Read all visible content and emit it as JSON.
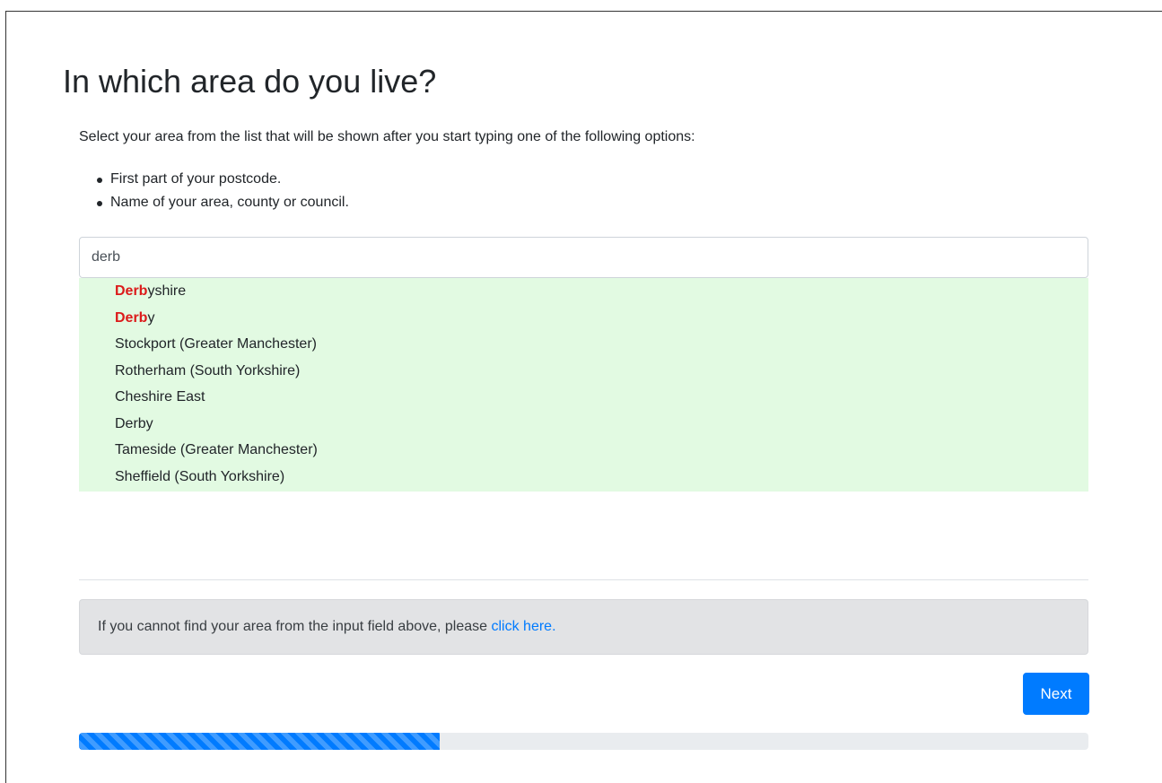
{
  "page": {
    "title": "In which area do you live?",
    "intro": "Select your area from the list that will be shown after you start typing one of the following options:",
    "options": [
      "First part of your postcode.",
      "Name of your area, county or council."
    ]
  },
  "search": {
    "value": "derb",
    "placeholder": ""
  },
  "suggestions": [
    {
      "match": "Derb",
      "rest": "yshire"
    },
    {
      "match": "Derb",
      "rest": "y"
    },
    {
      "match": "",
      "rest": "Stockport (Greater Manchester)"
    },
    {
      "match": "",
      "rest": "Rotherham (South Yorkshire)"
    },
    {
      "match": "",
      "rest": "Cheshire East"
    },
    {
      "match": "",
      "rest": "Derby"
    },
    {
      "match": "",
      "rest": "Tameside (Greater Manchester)"
    },
    {
      "match": "",
      "rest": "Sheffield (South Yorkshire)"
    }
  ],
  "notice": {
    "text": "If you cannot find your area from the input field above, please ",
    "link_text": "click here."
  },
  "buttons": {
    "next_label": "Next"
  },
  "progress": {
    "fraction": 0.357
  },
  "colors": {
    "primary": "#007bff",
    "highlight": "#dc1a1a",
    "suggestion_bg": "#e2fae2",
    "notice_bg": "#e2e3e5"
  }
}
